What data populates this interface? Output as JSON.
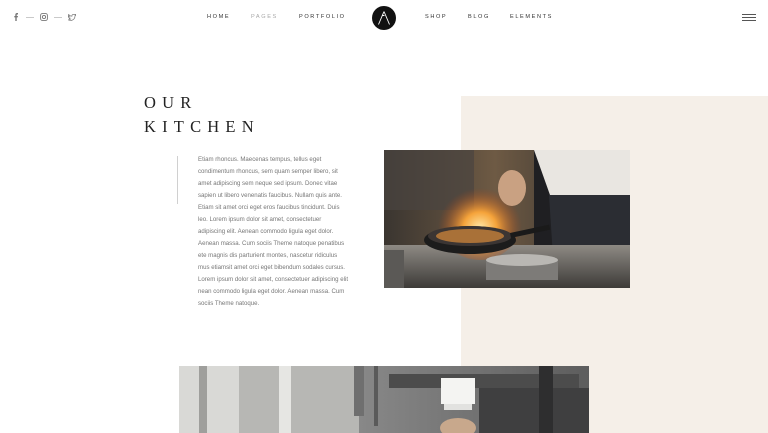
{
  "header": {
    "social_icons": [
      "facebook-icon",
      "instagram-icon",
      "twitter-icon"
    ],
    "nav_items": [
      {
        "label": "HOME",
        "active": false
      },
      {
        "label": "PAGES",
        "active": true
      },
      {
        "label": "PORTFOLIO",
        "active": false
      },
      {
        "label": "SHOP",
        "active": false
      },
      {
        "label": "BLOG",
        "active": false
      },
      {
        "label": "ELEMENTS",
        "active": false
      }
    ],
    "logo_letter": "A",
    "menu_icon": "hamburger-menu-icon"
  },
  "section": {
    "title_line1": "OUR",
    "title_line2": "KITCHEN",
    "body_lines": [
      "Etiam rhoncus. Maecenas tempus, tellus eget",
      "condimentum rhoncus, sem quam semper libero, sit",
      "amet adipiscing sem neque sed ipsum. Donec vitae",
      "sapien ut libero venenatis faucibus. Nullam quis ante.",
      "Etiam sit amet orci eget eros faucibus tincidunt. Duis",
      "leo. Lorem ipsum dolor sit amet, consectetuer",
      "adipiscing elit. Aenean commodo ligula eget dolor.",
      "Aenean massa. Cum sociis Theme natoque penatibus",
      "ete magnis dis parturient montes, nascetur ridiculus",
      "mus etiamsit amet orci eget bibendum sodales cursus.",
      "Lorem ipsum dolor sit amet, consectetuer adipiscing elit",
      "nean commodo ligula eget dolor. Aenean massa. Cum",
      "sociis Theme natoque."
    ]
  },
  "colors": {
    "beige": "#f5efe8",
    "text": "#777777",
    "heading": "#222222",
    "logo": "#111111"
  }
}
